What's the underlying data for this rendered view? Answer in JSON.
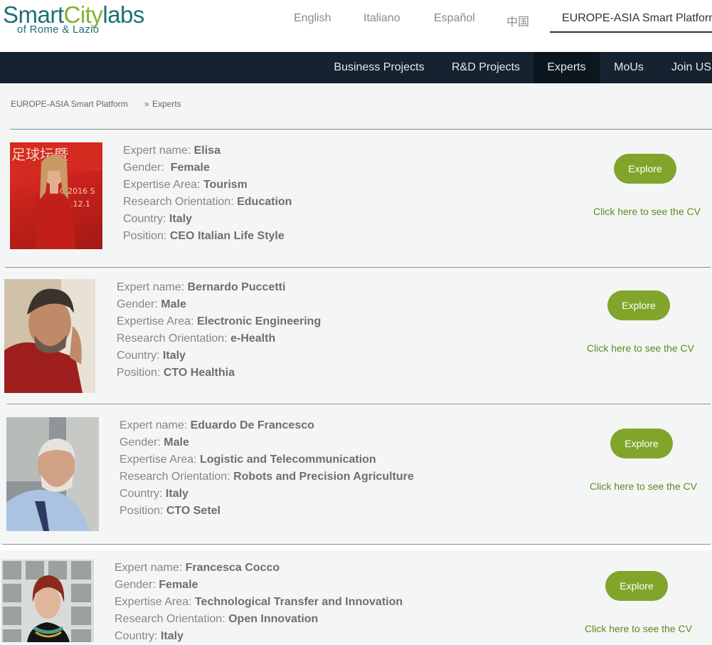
{
  "brand": {
    "name_part1": "Smart",
    "name_part2": "City",
    "name_part3": "labs",
    "subtitle": "of Rome & Lazio"
  },
  "languages": [
    "English",
    "Italiano",
    "Español",
    "中国"
  ],
  "platform_tab": "EUROPE-ASIA Smart Platform",
  "nav": [
    "Business Projects",
    "R&D Projects",
    "Experts",
    "MoUs",
    "Join US"
  ],
  "nav_active": "Experts",
  "breadcrumb": {
    "root": "EUROPE-ASIA Smart Platform",
    "separator": "»",
    "current": "Experts"
  },
  "labels": {
    "name": "Expert name:",
    "gender": "Gender:",
    "area": "Expertise Area:",
    "orientation": "Research Orientation:",
    "country": "Country:",
    "position": "Position:",
    "explore": "Explore",
    "cv": "Click here to see the CV"
  },
  "experts": [
    {
      "name": "Elisa",
      "gender": "Female",
      "area": "Tourism",
      "orientation": "Education",
      "country": "Italy",
      "position": "CEO Italian Life Style"
    },
    {
      "name": "Bernardo Puccetti",
      "gender": "Male",
      "area": "Electronic Engineering",
      "orientation": "e-Health",
      "country": "Italy",
      "position": "CTO Healthia"
    },
    {
      "name": "Eduardo De Francesco",
      "gender": "Male",
      "area": "Logistic and Telecommunication",
      "orientation": "Robots and Precision Agriculture",
      "country": "Italy",
      "position": "CTO Setel"
    },
    {
      "name": "Francesca Cocco",
      "gender": "Female",
      "area": "Technological Transfer and Innovation",
      "orientation": "Open Innovation",
      "country": "Italy",
      "position": ""
    }
  ],
  "colors": {
    "accent": "#80a52a",
    "nav_bg": "#14232f",
    "link": "#5c8a1f",
    "brand_teal": "#1e6f78"
  }
}
